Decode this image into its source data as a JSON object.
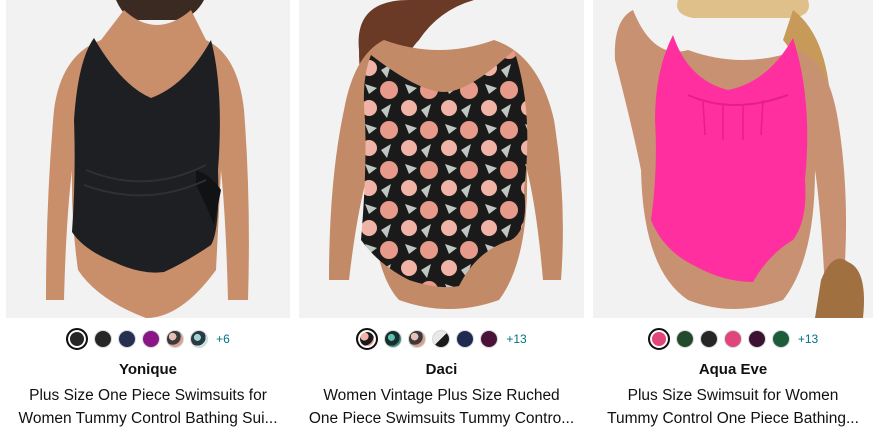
{
  "products": [
    {
      "brand": "Yonique",
      "title_line1": "Plus Size One Piece Swimsuits for",
      "title_line2": "Women Tummy Control Bathing Sui...",
      "more_colors": "+6",
      "swatches": [
        "#262626",
        "#262626",
        "#26304f",
        "#8a1585",
        "pattern-floral",
        "pattern-teal"
      ],
      "swimsuit_color": "#1d1f22"
    },
    {
      "brand": "Daci",
      "title_line1": "Women Vintage Plus Size Ruched",
      "title_line2": "One Piece Swimsuits Tummy Contro...",
      "more_colors": "+13",
      "swatches": [
        "pattern-floral",
        "pattern-teal",
        "pattern-floral",
        "pattern-split",
        "#1e2a52",
        "#4a1239"
      ],
      "swimsuit_color": "#1a1a1a"
    },
    {
      "brand": "Aqua Eve",
      "title_line1": "Plus Size Swimsuit for Women",
      "title_line2": "Tummy Control One Piece Bathing...",
      "more_colors": "+13",
      "swatches": [
        "#e0457b",
        "#244a2e",
        "#262626",
        "#e0457b",
        "#3b1230",
        "#1b5c3a"
      ],
      "swimsuit_color": "#ff2fa0"
    }
  ]
}
